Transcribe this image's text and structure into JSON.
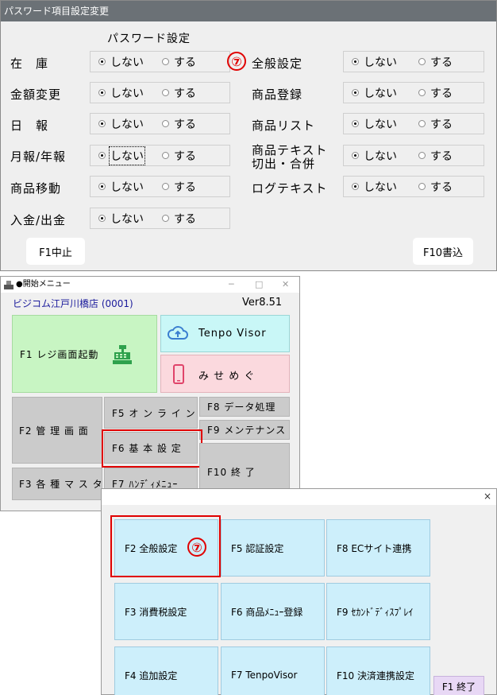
{
  "password_window": {
    "title": "パスワード項目設定変更",
    "header": "パスワード設定",
    "option_off": "しない",
    "option_on": "する",
    "marker": "⑦",
    "rows_left": [
      {
        "label": "在　庫"
      },
      {
        "label": "金額変更"
      },
      {
        "label": "日　報"
      },
      {
        "label": "月報/年報"
      },
      {
        "label": "商品移動"
      },
      {
        "label": "入金/出金"
      }
    ],
    "rows_right": [
      {
        "label": "全般設定"
      },
      {
        "label": "商品登録"
      },
      {
        "label": "商品リスト"
      },
      {
        "label_line1": "商品テキスト",
        "label_line2": "切出・合併"
      },
      {
        "label": "ログテキスト"
      }
    ],
    "cancel_button": "F1中止",
    "save_button": "F10書込"
  },
  "menu_window": {
    "title": "●開始メニュー",
    "store": "ビジコム江戸川橋店 (0001)",
    "version": "Ver8.51",
    "tiles": {
      "register": "F1 レジ画面起動",
      "tenpo_visor": "Tenpo Visor",
      "misemegu": "み せ め ぐ",
      "admin": "F2 管 理 画 面",
      "online": "F5 オ ン ラ イ ン",
      "data": "F8 データ処理",
      "maintenance": "F9 メンテナンス",
      "basic": "F6 基 本 設 定",
      "exit": "F10 終 了",
      "master": "F3 各 種 マ ス タ",
      "handy": "F7 ﾊﾝﾃﾞｨﾒﾆｭｰ"
    }
  },
  "settings_window": {
    "close": "×",
    "marker": "⑦",
    "tiles": {
      "general": "F2 全般設定",
      "auth": "F5 認証設定",
      "ec": "F8 ECサイト連携",
      "tax": "F3 消費税設定",
      "menu_reg": "F6 商品ﾒﾆｭｰ登録",
      "second_display": "F9 ｾｶﾝﾄﾞﾃﾞｨｽﾌﾟﾚｲ",
      "extra": "F4 追加設定",
      "tenpovisor": "F7 TenpoVisor",
      "payment": "F10 決済連携設定"
    },
    "exit": "F1 終了"
  },
  "colors": {
    "title_bar": "#6b7176",
    "marker_red": "#e00000",
    "register_tile": "#c8f5c3",
    "tenpo_tile": "#c9f7f7",
    "misemegu_tile": "#fbd9de",
    "setting_tile": "#cdeffb",
    "exit_tile": "#e8d8f5"
  }
}
